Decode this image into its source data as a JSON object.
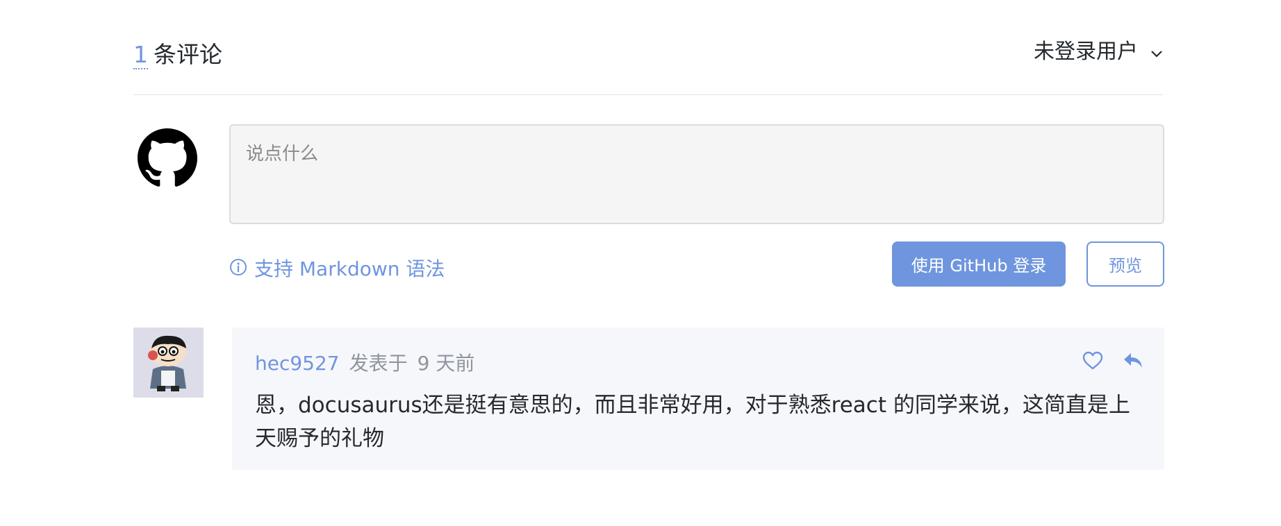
{
  "header": {
    "count": "1",
    "count_suffix": "条评论",
    "user_menu_label": "未登录用户"
  },
  "composer": {
    "placeholder": "说点什么",
    "markdown_hint": "支持 Markdown 语法",
    "login_button": "使用 GitHub 登录",
    "preview_button": "预览"
  },
  "comments": [
    {
      "author": "hec9527",
      "posted_label": "发表于",
      "time": "9 天前",
      "body": "恩，docusaurus还是挺有意思的，而且非常好用，对于熟悉react 的同学来说，这简直是上天赐予的礼物",
      "actions": [
        "heart-icon",
        "reply-icon"
      ]
    }
  ],
  "colors": {
    "accent": "#6f95de",
    "comment_bg": "#f6f7fb",
    "textarea_bg": "#f5f5f5",
    "divider": "#e1e4e8"
  }
}
